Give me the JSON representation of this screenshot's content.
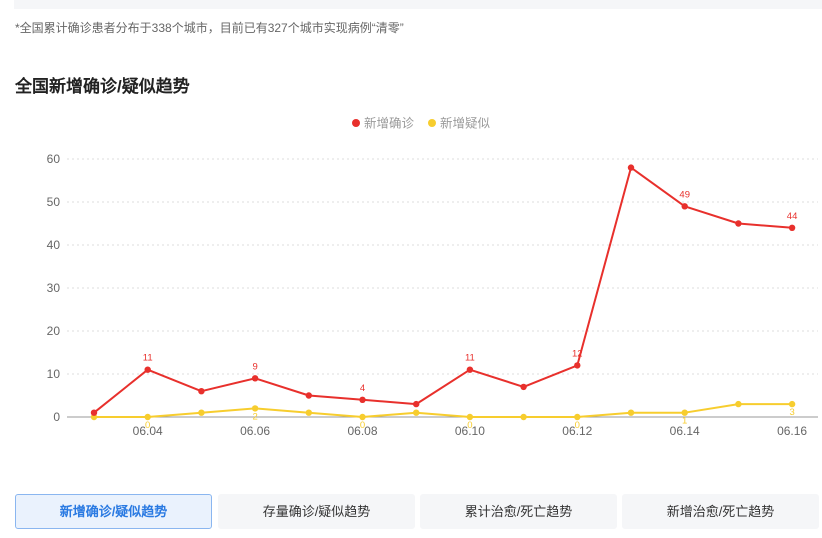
{
  "note": "*全国累计确诊患者分布于338个城市，目前已有327个城市实现病例“清零”",
  "section_title": "全国新增确诊/疑似趋势",
  "colors": {
    "confirmed": "#e8302c",
    "suspected": "#f7cd2e",
    "grid": "#dddddd",
    "axis_text": "#666666",
    "legend_text": "#999999"
  },
  "chart_data": {
    "type": "line",
    "x": [
      "06.03",
      "06.04",
      "06.05",
      "06.06",
      "06.07",
      "06.08",
      "06.09",
      "06.10",
      "06.11",
      "06.12",
      "06.13",
      "06.14",
      "06.15",
      "06.16"
    ],
    "x_tick_labels": [
      "06.04",
      "06.06",
      "06.08",
      "06.10",
      "06.12",
      "06.14",
      "06.16"
    ],
    "ylim": [
      0,
      60
    ],
    "y_ticks": [
      0,
      10,
      20,
      30,
      40,
      50,
      60
    ],
    "grid": true,
    "legend_position": "top-center",
    "series": [
      {
        "name": "新增确诊",
        "color": "#e8302c",
        "values": [
          1,
          11,
          6,
          9,
          5,
          4,
          3,
          11,
          7,
          12,
          58,
          49,
          45,
          44
        ],
        "labeled_points": [
          1,
          3,
          5,
          7,
          9,
          11,
          13
        ]
      },
      {
        "name": "新增疑似",
        "color": "#f7cd2e",
        "values": [
          0,
          0,
          1,
          2,
          1,
          0,
          1,
          0,
          0,
          0,
          1,
          1,
          3,
          3
        ],
        "labeled_points": [
          1,
          3,
          5,
          7,
          9,
          11,
          13
        ]
      }
    ]
  },
  "tabs": [
    {
      "label": "新增确诊/疑似趋势",
      "active": true
    },
    {
      "label": "存量确诊/疑似趋势",
      "active": false
    },
    {
      "label": "累计治愈/死亡趋势",
      "active": false
    },
    {
      "label": "新增治愈/死亡趋势",
      "active": false
    }
  ]
}
